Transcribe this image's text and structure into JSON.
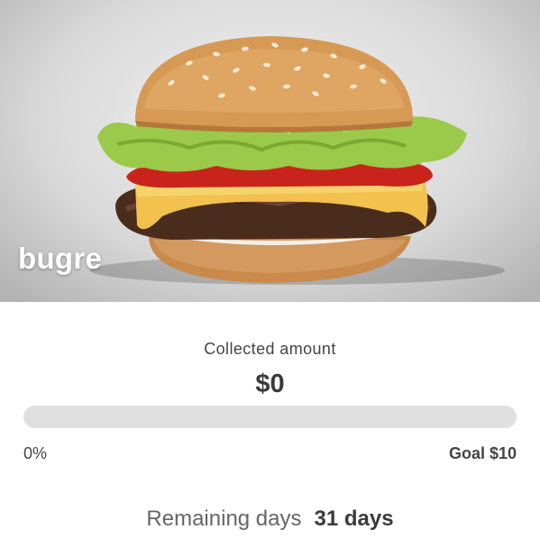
{
  "campaign": {
    "title": "bugre",
    "image_icon": "burger-image"
  },
  "funding": {
    "collected_label": "Collected amount",
    "collected_amount": "$0",
    "progress_percent": 0,
    "progress_label": "0%",
    "goal_label": "Goal $10"
  },
  "timeline": {
    "remaining_label": "Remaining days",
    "remaining_value": "31 days"
  },
  "colors": {
    "progress_track": "#e0e0e0",
    "progress_fill": "#4caf50"
  }
}
